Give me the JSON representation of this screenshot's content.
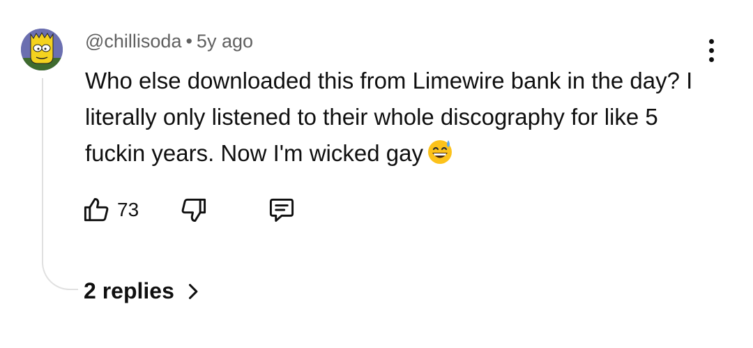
{
  "comment": {
    "author": "@chillisoda",
    "separator": "•",
    "time": "5y ago",
    "text": "Who else downloaded this from Limewire bank in the day? I literally only listened to their whole discography for like 5 fuckin years. Now I'm wicked gay",
    "emoji": "grinning-face-with-sweat-icon",
    "likes": "73",
    "replies_label": "2 replies"
  },
  "icons": {
    "like": "thumbs-up-icon",
    "dislike": "thumbs-down-icon",
    "reply": "reply-comment-icon",
    "more": "more-vert-icon",
    "chevron": "chevron-right-icon"
  },
  "colors": {
    "text": "#0f0f0f",
    "meta": "#606060",
    "thread_line": "#e0e0e0",
    "avatar_bg": "#6b6fb0"
  }
}
